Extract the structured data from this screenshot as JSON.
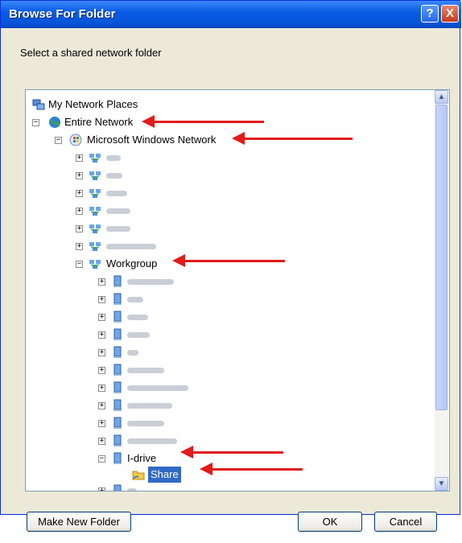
{
  "window": {
    "title": "Browse For Folder",
    "help_label": "?",
    "close_label": "X"
  },
  "instruction": "Select a shared network folder",
  "tree": {
    "root": "My Network Places",
    "entire_network": "Entire Network",
    "windows_network": "Microsoft Windows Network",
    "workgroup": "Workgroup",
    "idrive": "I-drive",
    "share": "Share"
  },
  "scrollbar": {
    "up": "▲",
    "down": "▼"
  },
  "buttons": {
    "make_new_folder": "Make New Folder",
    "ok": "OK",
    "cancel": "Cancel"
  },
  "expanders": {
    "collapsed": "+",
    "expanded": "−"
  },
  "colors": {
    "selection": "#316ac5",
    "arrow": "#e21a1a",
    "title_bar": "#0653d6"
  }
}
